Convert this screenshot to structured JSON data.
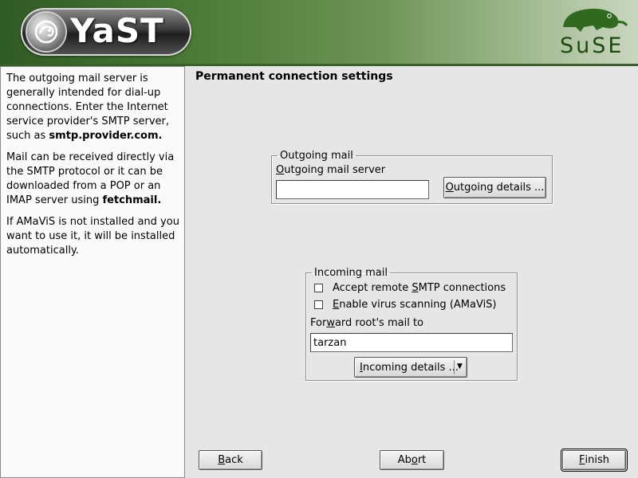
{
  "header": {
    "app_name": "YaST",
    "vendor_name": "SuSE"
  },
  "help": {
    "p1_pre": "The outgoing mail server is generally intended for dial-up connections. Enter the Internet service provider's SMTP server, such as ",
    "p1_bold": "smtp.provider.com.",
    "p2_pre": "Mail can be received directly via the SMTP protocol or it can be downloaded from a POP or an IMAP server using ",
    "p2_bold": "fetchmail.",
    "p3": "If AMaViS is not installed and you want to use it, it will be installed automatically."
  },
  "page_title": "Permanent connection settings",
  "outgoing": {
    "legend": "Outgoing mail",
    "server_label_mnemonic": "O",
    "server_label_rest": "utgoing mail server",
    "server_value": "",
    "details_mnemonic": "O",
    "details_rest": "utgoing details ..."
  },
  "incoming": {
    "legend": "Incoming mail",
    "accept_pre": "Accept remote ",
    "accept_mnemonic": "S",
    "accept_post": "MTP connections",
    "accept_checked": false,
    "virus_mnemonic": "E",
    "virus_rest": "nable virus scanning (AMaViS)",
    "virus_checked": false,
    "forward_pre": "For",
    "forward_mnemonic": "w",
    "forward_post": "ard root's mail to",
    "forward_value": "tarzan",
    "details_mnemonic": "I",
    "details_rest": "ncoming details ...",
    "details_arrow": "▼"
  },
  "buttons": {
    "back_mnemonic": "B",
    "back_rest": "ack",
    "abort_pre": "Ab",
    "abort_mnemonic": "o",
    "abort_post": "rt",
    "finish_mnemonic": "F",
    "finish_rest": "inish"
  },
  "colors": {
    "header_green": "#4a7a36",
    "suse_green": "#1c4a11",
    "background": "#e6e6e6"
  }
}
